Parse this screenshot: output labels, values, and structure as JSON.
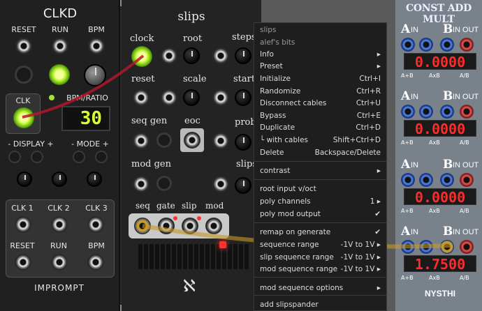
{
  "clkd": {
    "title": "CLKD",
    "labels_top": [
      "RESET",
      "RUN",
      "BPM"
    ],
    "clk_label": "CLK",
    "bpm_ratio_label": "BPM/RATIO",
    "display_value": "30",
    "display_label": "- DISPLAY +",
    "mode_label": "- MODE +",
    "clk_outs": [
      "CLK 1",
      "CLK 2",
      "CLK 3"
    ],
    "outs_bottom": [
      "RESET",
      "RUN",
      "BPM"
    ],
    "brand": "IMPROMPT",
    "colors": {
      "led": "#b8f22a",
      "display": "#d8ff30"
    }
  },
  "slips": {
    "title": "slips",
    "labels": [
      "clock",
      "root",
      "steps",
      "reset",
      "scale",
      "start",
      "seq gen",
      "eoc",
      "prob",
      "mod gen",
      "slips"
    ],
    "bottom_labels": [
      "seq",
      "gate",
      "slip",
      "mod"
    ],
    "logo": "ℵ"
  },
  "menu": {
    "header1": "slips",
    "header2": "alef's bits",
    "items": [
      {
        "label": "Info",
        "right": "▸"
      },
      {
        "label": "Preset",
        "right": "▸"
      },
      {
        "label": "Initialize",
        "right": "Ctrl+I"
      },
      {
        "label": "Randomize",
        "right": "Ctrl+R"
      },
      {
        "label": "Disconnect cables",
        "right": "Ctrl+U"
      },
      {
        "label": "Bypass",
        "right": "Ctrl+E"
      },
      {
        "label": "Duplicate",
        "right": "Ctrl+D"
      },
      {
        "label": "└ with cables",
        "right": "Shift+Ctrl+D"
      },
      {
        "label": "Delete",
        "right": "Backspace/Delete"
      }
    ],
    "contrast": {
      "label": "contrast",
      "right": "▸"
    },
    "settings": [
      {
        "label": "root input v/oct",
        "right": ""
      },
      {
        "label": "poly channels",
        "right": "1 ▸"
      },
      {
        "label": "poly mod output",
        "right": "✔"
      }
    ],
    "gen": [
      {
        "label": "remap on generate",
        "right": "✔"
      },
      {
        "label": "sequence range",
        "right": "-1V to 1V ▸"
      },
      {
        "label": "slip sequence range",
        "right": "-1V to 1V ▸"
      },
      {
        "label": "mod sequence range",
        "right": "-1V to 1V ▸"
      }
    ],
    "mod_options": {
      "label": "mod sequence options",
      "right": "▸"
    },
    "add": {
      "label": "add slipspander"
    }
  },
  "cam": {
    "title": "CONST ADD MULT",
    "in_a": "A",
    "in_label": "IN",
    "in_b": "B",
    "out_label": "IN OUT",
    "ops": [
      "A+B",
      "AxB",
      "A/B"
    ],
    "values": [
      "0.0000",
      "0.0000",
      "0.0000",
      "1.7500"
    ],
    "brand": "NYSTHI",
    "colors": {
      "display": "#ff2a2a",
      "jack_blue": "#4a78d8",
      "jack_red": "#d84a4a"
    }
  }
}
